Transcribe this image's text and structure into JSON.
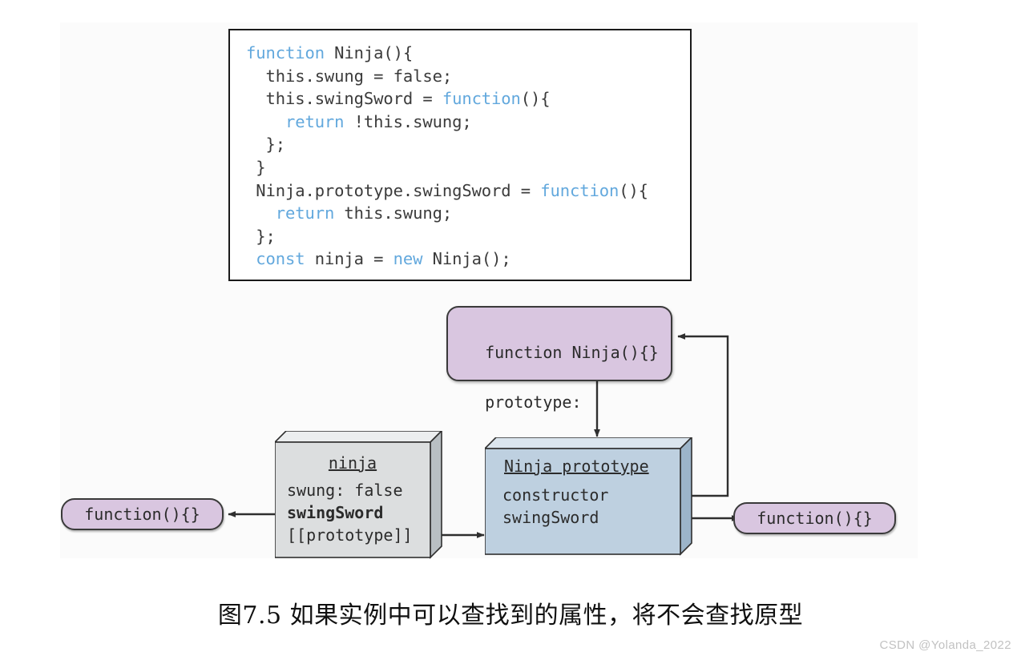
{
  "figure": {
    "caption": "图7.5   如果实例中可以查找到的属性，将不会查找原型",
    "watermark": "CSDN @Yolanda_2022"
  },
  "code": {
    "language": "javascript",
    "lines": [
      [
        {
          "t": "function",
          "k": true
        },
        {
          "t": " Ninja(){",
          "k": false
        }
      ],
      [
        {
          "t": "  this.swung = false;",
          "k": false
        }
      ],
      [
        {
          "t": "  this.swingSword = ",
          "k": false
        },
        {
          "t": "function",
          "k": true
        },
        {
          "t": "(){",
          "k": false
        }
      ],
      [
        {
          "t": "    ",
          "k": false
        },
        {
          "t": "return",
          "k": true
        },
        {
          "t": " !this.swung;",
          "k": false
        }
      ],
      [
        {
          "t": "  };",
          "k": false
        }
      ],
      [
        {
          "t": " }",
          "k": false
        }
      ],
      [
        {
          "t": " Ninja.prototype.swingSword = ",
          "k": false
        },
        {
          "t": "function",
          "k": true
        },
        {
          "t": "(){",
          "k": false
        }
      ],
      [
        {
          "t": "   ",
          "k": false
        },
        {
          "t": "return",
          "k": true
        },
        {
          "t": " this.swung;",
          "k": false
        }
      ],
      [
        {
          "t": " };",
          "k": false
        }
      ],
      [
        {
          "t": " ",
          "k": false
        },
        {
          "t": "const",
          "k": true
        },
        {
          "t": " ninja = ",
          "k": false
        },
        {
          "t": "new",
          "k": true
        },
        {
          "t": " Ninja();",
          "k": false
        }
      ]
    ]
  },
  "diagram": {
    "ninja_function_box": {
      "line1": "function Ninja(){}",
      "line2": "prototype:"
    },
    "ninja_instance_box": {
      "title": "ninja",
      "props": [
        "swung: false",
        "swingSword",
        "[[prototype]]"
      ],
      "bold_prop": "swingSword"
    },
    "ninja_prototype_box": {
      "title": "Ninja prototype",
      "props": [
        "constructor",
        "swingSword"
      ]
    },
    "left_function_pill": "function(){}",
    "right_function_pill": "function(){}"
  },
  "colors": {
    "purple_fill": "#d9c6e0",
    "gray_fill": "#dcdedf",
    "blue_fill": "#bed0e0",
    "keyword_blue": "#62a8dd",
    "code_text": "#3b3b3b",
    "stroke": "#2f2f2f",
    "band": "#fbfbfb"
  }
}
